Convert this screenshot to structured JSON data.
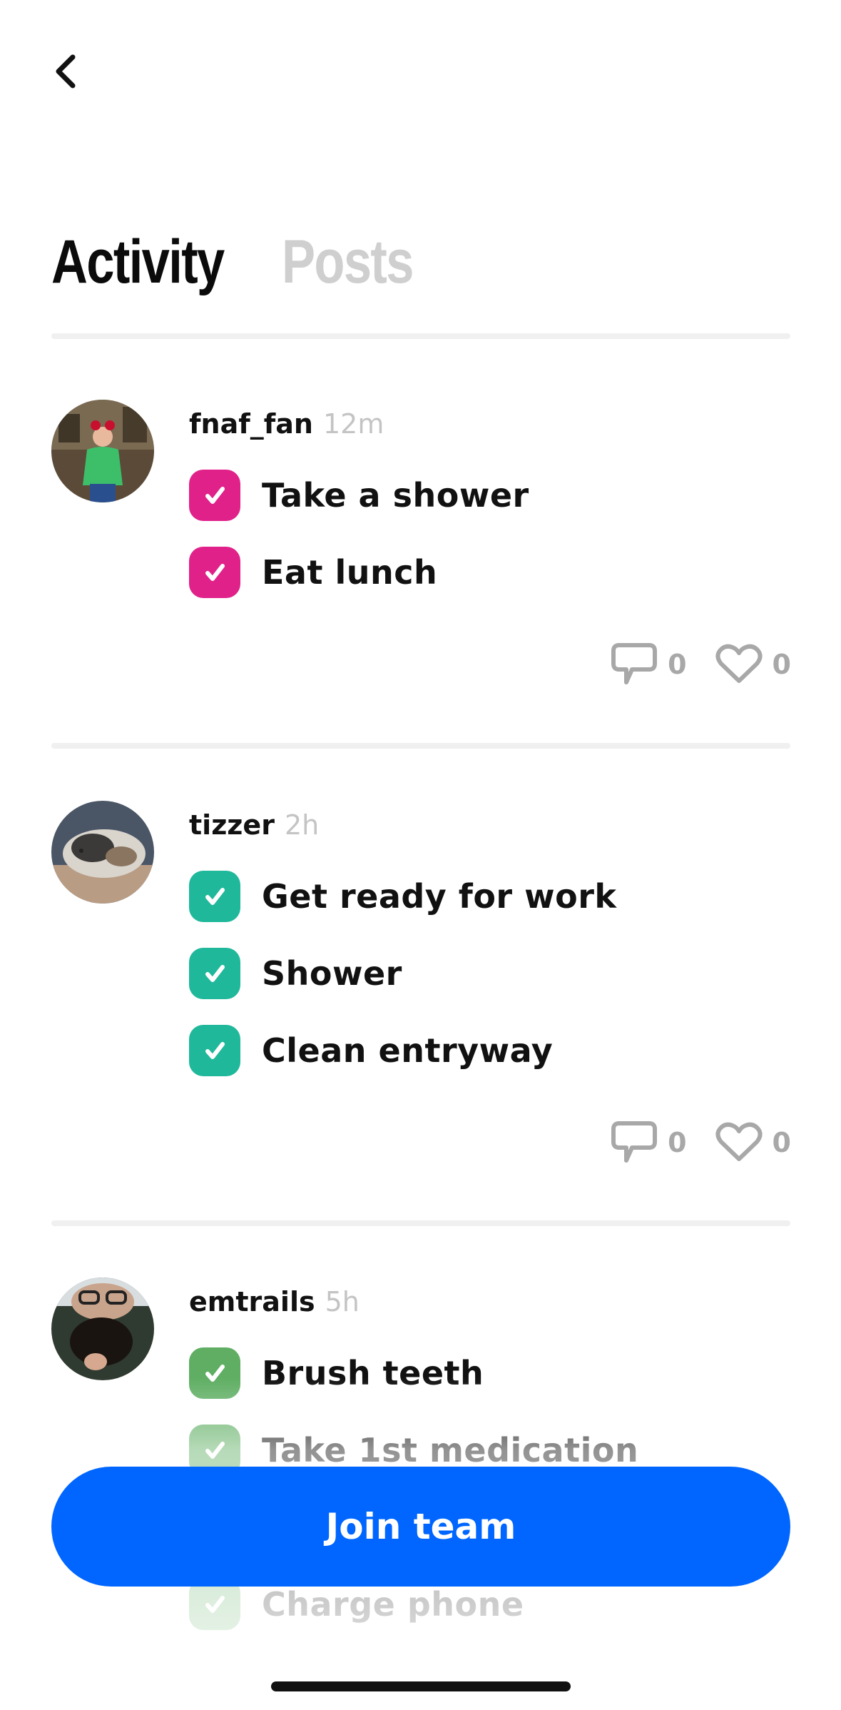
{
  "header": {
    "back_icon": "chevron-left-icon"
  },
  "tabs": [
    {
      "label": "Activity",
      "active": true
    },
    {
      "label": "Posts",
      "active": false
    }
  ],
  "feed": [
    {
      "username": "fnaf_fan",
      "time": "12m",
      "accent": "#e0218a",
      "tasks": [
        "Take a shower",
        "Eat lunch"
      ],
      "comments": "0",
      "likes": "0"
    },
    {
      "username": "tizzer",
      "time": "2h",
      "accent": "#1fb89a",
      "tasks": [
        "Get ready for work",
        "Shower",
        "Clean entryway"
      ],
      "comments": "0",
      "likes": "0"
    },
    {
      "username": "emtrails",
      "time": "5h",
      "accent": "#5fae63",
      "tasks": [
        "Brush teeth",
        "Take 1st medication",
        "Charge phone"
      ],
      "comments": "",
      "likes": ""
    }
  ],
  "cta": {
    "label": "Join team",
    "color": "#0066ff"
  },
  "icons": {
    "comment": "comment-bubble-icon",
    "like": "heart-icon",
    "check": "checkmark-icon"
  }
}
